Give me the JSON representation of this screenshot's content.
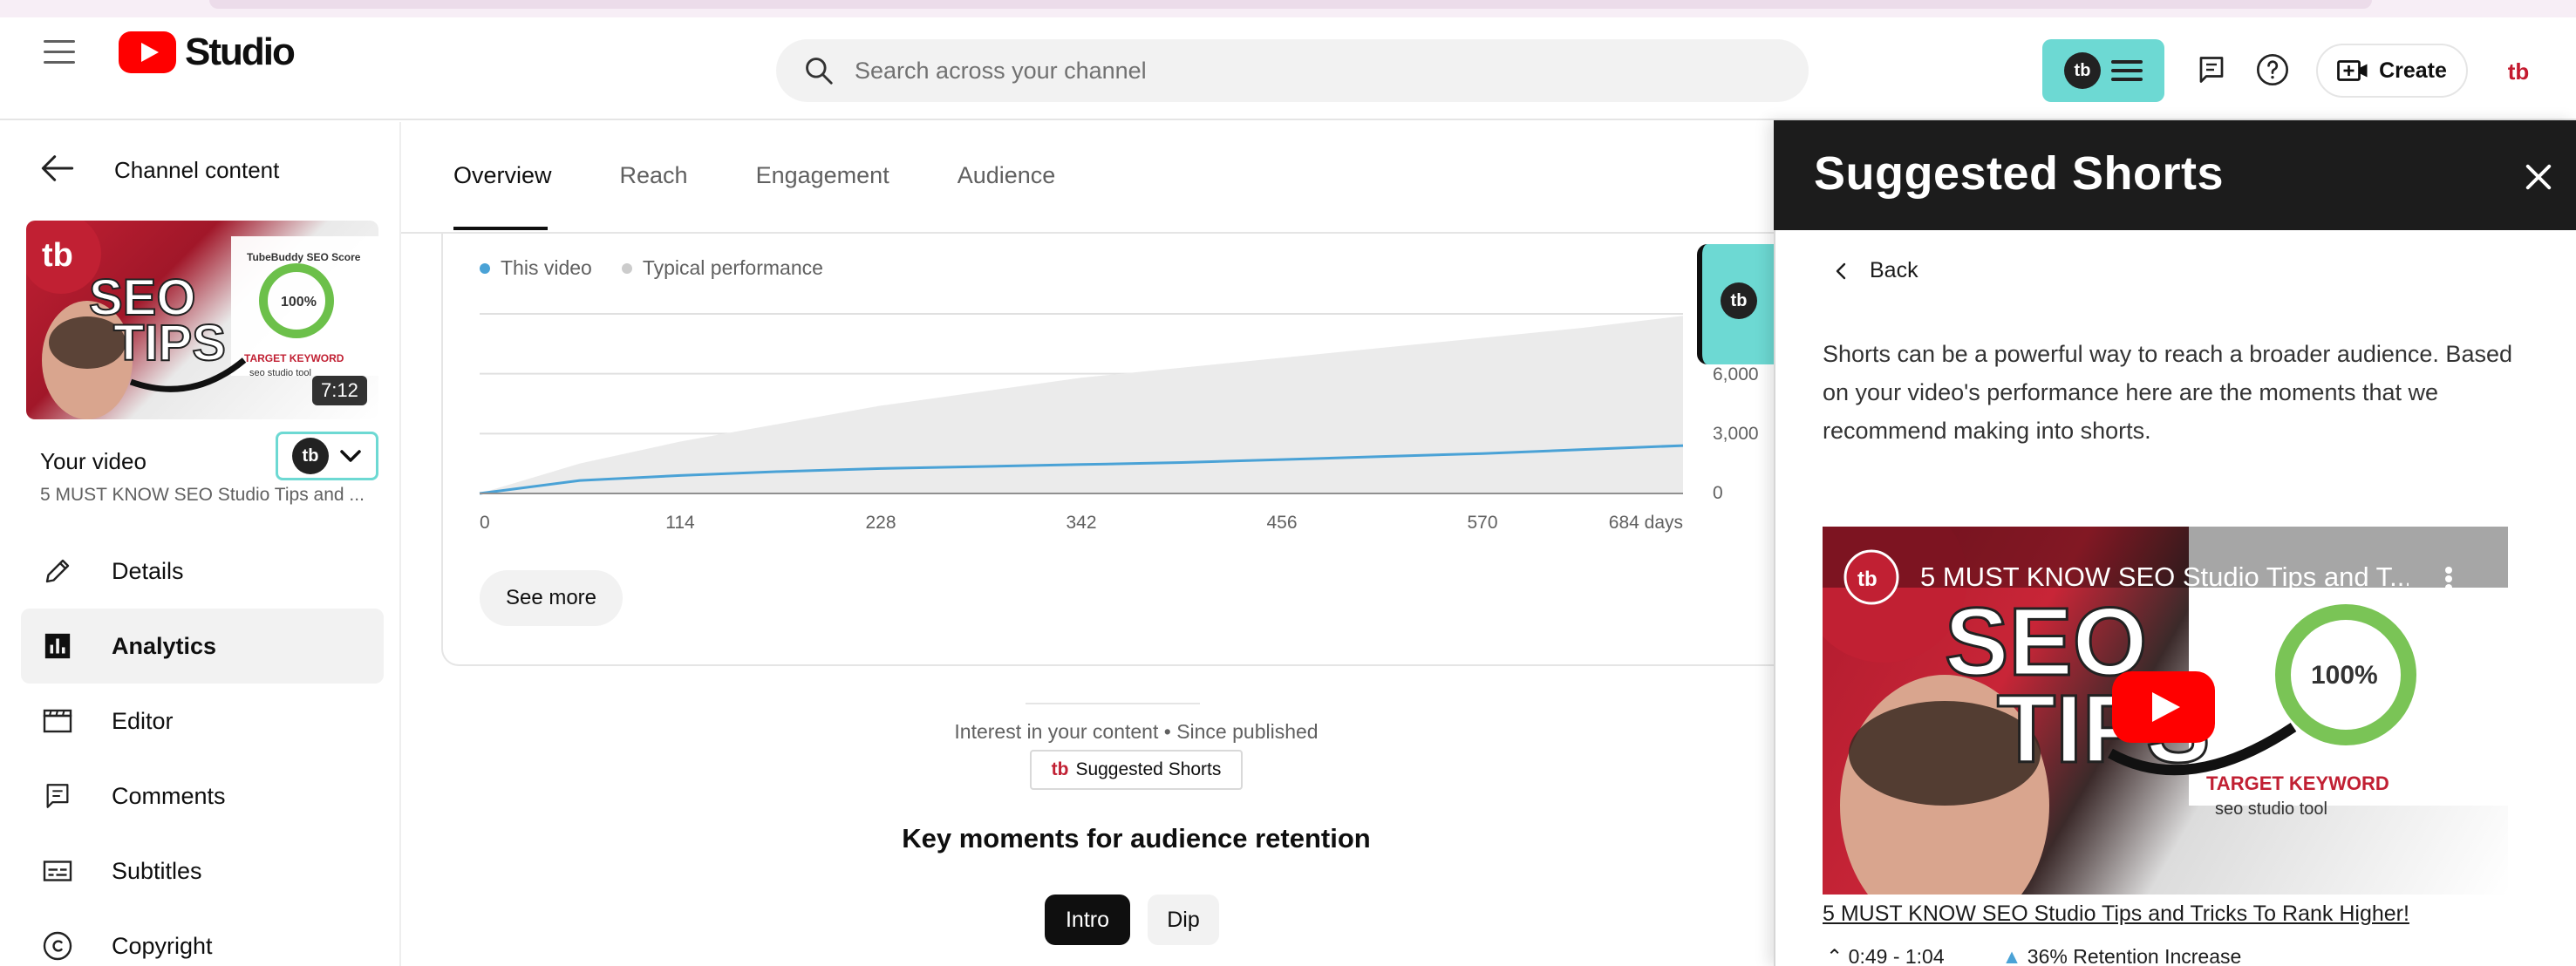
{
  "header": {
    "logo_text": "Studio",
    "search_placeholder": "Search across your channel",
    "create_label": "Create"
  },
  "sidebar": {
    "back_label": "Channel content",
    "video_duration": "7:12",
    "your_video_label": "Your video",
    "video_subtitle": "5 MUST KNOW SEO Studio Tips and ...",
    "items": [
      {
        "label": "Details",
        "icon": "pencil-icon"
      },
      {
        "label": "Analytics",
        "icon": "analytics-icon",
        "active": true
      },
      {
        "label": "Editor",
        "icon": "clapperboard-icon"
      },
      {
        "label": "Comments",
        "icon": "comments-icon"
      },
      {
        "label": "Subtitles",
        "icon": "subtitles-icon"
      },
      {
        "label": "Copyright",
        "icon": "copyright-icon"
      }
    ]
  },
  "main": {
    "tabs": [
      "Overview",
      "Reach",
      "Engagement",
      "Audience"
    ],
    "active_tab": "Overview",
    "see_more_label": "See more",
    "interest_text": "Interest in your content • Since published",
    "suggested_shorts_chip": "Suggested Shorts",
    "key_moments_title": "Key moments for audience retention",
    "pills": [
      "Intro",
      "Dip"
    ]
  },
  "chart_data": {
    "type": "area",
    "legend": [
      {
        "name": "This video",
        "color": "#4aa2d6"
      },
      {
        "name": "Typical performance",
        "color": "#cccccc"
      }
    ],
    "x_ticks": [
      "0",
      "114",
      "228",
      "342",
      "456",
      "570",
      "684 days"
    ],
    "y_ticks": [
      "6,000",
      "3,000",
      "0"
    ],
    "xlim": [
      0,
      684
    ],
    "ylim": [
      0,
      9000
    ],
    "series": [
      {
        "name": "This video",
        "x": [
          0,
          57,
          114,
          171,
          228,
          285,
          342,
          399,
          456,
          513,
          570,
          627,
          684
        ],
        "values": [
          0,
          650,
          900,
          1100,
          1250,
          1350,
          1450,
          1550,
          1700,
          1850,
          2000,
          2200,
          2400
        ]
      },
      {
        "name": "Typical performance",
        "x": [
          0,
          57,
          114,
          171,
          228,
          285,
          342,
          399,
          456,
          513,
          570,
          627,
          684
        ],
        "values": [
          0,
          1500,
          2600,
          3500,
          4400,
          5100,
          5800,
          6300,
          6800,
          7300,
          7800,
          8300,
          8900
        ]
      }
    ]
  },
  "panel": {
    "title": "Suggested Shorts",
    "back_label": "Back",
    "description": "Shorts can be a powerful way to reach a broader audience. Based on your video's performance here are the moments that we recommend making into shorts.",
    "video_overlay_title": "5 MUST KNOW SEO Studio Tips and T...",
    "video_link": "5 MUST KNOW SEO Studio Tips and Tricks To Rank Higher!",
    "moment_range": "0:49 - 1:04",
    "retention_increase": "36% Retention Increase"
  },
  "thumbnail": {
    "text_seo": "SEO",
    "text_tips": "TIPS",
    "score_title": "TubeBuddy SEO Score",
    "score": "100%",
    "keyword": "TARGET KEYWORD",
    "keyword_value": "seo studio tool"
  },
  "colors": {
    "brand_red": "#ff0000",
    "tubebuddy_teal": "#6dd9d3",
    "this_video_line": "#4aa2d6",
    "typical_area": "#ebebeb"
  }
}
